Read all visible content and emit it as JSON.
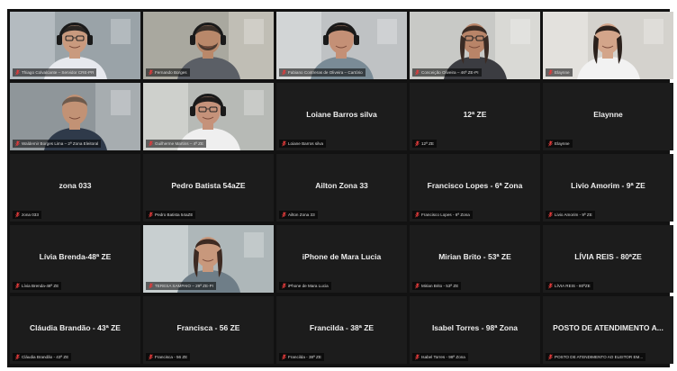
{
  "colors": {
    "muted_mic": "#e23b3b",
    "stage_bg": "#121212",
    "tile_bg": "#1c1c1c"
  },
  "participants": [
    {
      "name": "",
      "label": "Thiago Colvalcante – Servidor CRE-PR",
      "video": true,
      "scene": "office-headset-glasses"
    },
    {
      "name": "",
      "label": "Fernando Borges",
      "video": true,
      "scene": "office-headset-beard"
    },
    {
      "name": "",
      "label": "Fabiano Contreras de Oliveira – Cartório",
      "video": true,
      "scene": "office-headset-young"
    },
    {
      "name": "",
      "label": "Conceição Oliveira – 46ª ZE-PI",
      "video": true,
      "scene": "office-woman-glasses"
    },
    {
      "name": "",
      "label": "Elaynne",
      "video": true,
      "scene": "office-woman-smile"
    },
    {
      "name": "",
      "label": "Waldemir Borges Lima – 2ª Zona Eleitoral",
      "video": true,
      "scene": "office-man-bald"
    },
    {
      "name": "",
      "label": "Guilherme Martins – 4ª ZE",
      "video": true,
      "scene": "office-man-headset-glasses"
    },
    {
      "name": "Loiane Barros silva",
      "label": "Loiane Barros silva",
      "video": false
    },
    {
      "name": "12ª ZE",
      "label": "12ª ZE",
      "video": false
    },
    {
      "name": "Elaynne",
      "label": "Elaynne",
      "video": false
    },
    {
      "name": "zona 033",
      "label": "zona 033",
      "video": false
    },
    {
      "name": "Pedro Batista 54aZE",
      "label": "Pedro Batista 54aZE",
      "video": false
    },
    {
      "name": "Ailton Zona 33",
      "label": "Ailton Zona 33",
      "video": false
    },
    {
      "name": "Francisco Lopes - 6ª Zona",
      "label": "Francisco Lopes - 6ª Zona",
      "video": false
    },
    {
      "name": "Livio Amorim - 9ª ZE",
      "label": "Livio Amorim - 9ª ZE",
      "video": false
    },
    {
      "name": "Lívia Brenda-48ª ZE",
      "label": "Lívia Brenda-48ª ZE",
      "video": false
    },
    {
      "name": "",
      "label": "TERESA SAMPAIO – 29ª ZE-PI",
      "video": true,
      "scene": "office-woman-hair"
    },
    {
      "name": "iPhone de Mara Lucia",
      "label": "iPhone de Mara Lucia",
      "video": false
    },
    {
      "name": "Mirian Brito - 53ª ZE",
      "label": "Mirian Brito - 53ª ZE",
      "video": false
    },
    {
      "name": "LÍVIA REIS - 80ªZE",
      "label": "LÍVIA REIS - 80ªZE",
      "video": false
    },
    {
      "name": "Cláudia Brandão - 43ª ZE",
      "label": "Cláudia Brandão - 43ª ZE",
      "video": false
    },
    {
      "name": "Francisca - 56 ZE",
      "label": "Francisca - 56 ZE",
      "video": false
    },
    {
      "name": "Francilda - 38ª ZE",
      "label": "Francilda - 38ª ZE",
      "video": false
    },
    {
      "name": "Isabel Torres - 98ª Zona",
      "label": "Isabel Torres - 98ª Zona",
      "video": false
    },
    {
      "name": "POSTO DE ATENDIMENTO A...",
      "label": "POSTO DE ATENDIMENTO AO ELEITOR EM...",
      "video": false
    }
  ]
}
